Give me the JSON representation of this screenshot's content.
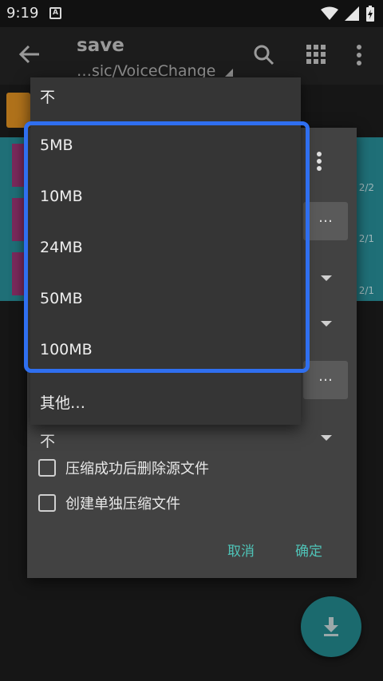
{
  "status_bar": {
    "time": "9:19",
    "notification_icon": "A"
  },
  "app_bar": {
    "title": "save",
    "path": "…sic/VoiceChange"
  },
  "list": {
    "counts": [
      "2/2",
      "2/1",
      "2/1"
    ]
  },
  "dialog": {
    "field_button_label": "…",
    "select_value": "不",
    "checkboxes": [
      {
        "label": "压缩成功后删除源文件",
        "checked": false
      },
      {
        "label": "创建单独压缩文件",
        "checked": false
      }
    ],
    "cancel_label": "取消",
    "ok_label": "确定"
  },
  "dropdown": {
    "items": [
      "不",
      "5MB",
      "10MB",
      "24MB",
      "50MB",
      "100MB",
      "其他…"
    ]
  },
  "colors": {
    "highlight": "#2f6ff0",
    "accent": "#4fc3b7",
    "fab": "#1b6a6e"
  }
}
